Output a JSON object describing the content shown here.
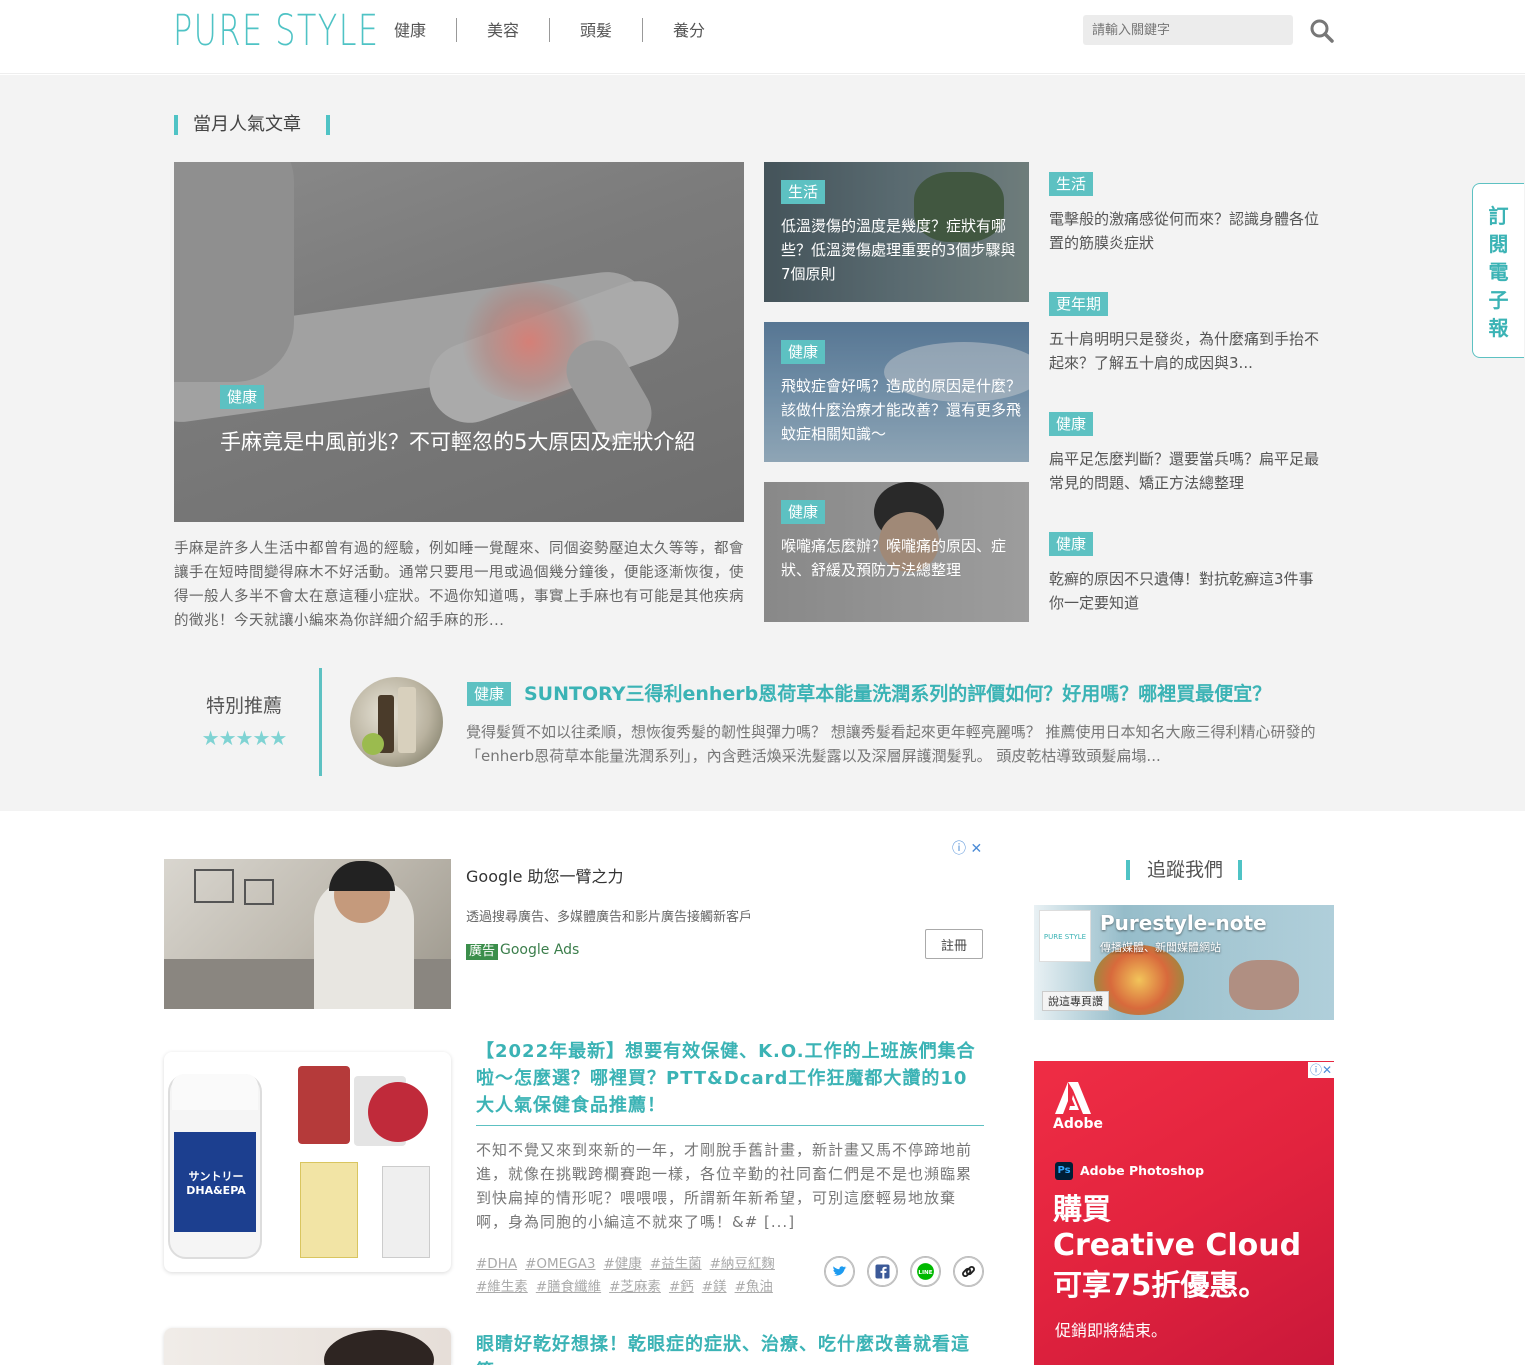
{
  "header": {
    "logo": "PURE STYLE",
    "nav": [
      "健康",
      "美容",
      "頭髮",
      "養分"
    ],
    "search_placeholder": "請輸入關鍵字"
  },
  "featured": {
    "section_title": "當月人氣文章",
    "main": {
      "tag": "健康",
      "title": "手麻竟是中風前兆？不可輕忽的5大原因及症狀介紹",
      "excerpt": "手麻是許多人生活中都曾有過的經驗，例如睡一覺醒來、同個姿勢壓迫太久等等，都會讓手在短時間變得麻木不好活動。通常只要甩一甩或過個幾分鐘後，便能逐漸恢復，使得一般人多半不會太在意這種小症狀。不過你知道嗎，事實上手麻也有可能是其他疾病的徵兆！今天就讓小編來為你詳細介紹手麻的形..."
    },
    "middle": [
      {
        "tag": "生活",
        "title": "低溫燙傷的溫度是幾度？症狀有哪些？低溫燙傷處理重要的3個步驟與7個原則"
      },
      {
        "tag": "健康",
        "title": "飛蚊症會好嗎？造成的原因是什麼？該做什麼治療才能改善？還有更多飛蚊症相關知識～"
      },
      {
        "tag": "健康",
        "title": "喉嚨痛怎麼辦？喉嚨痛的原因、症狀、舒緩及預防方法總整理"
      }
    ],
    "side": [
      {
        "tag": "生活",
        "title": "電擊般的激痛感從何而來？認識身體各位置的筋膜炎症狀"
      },
      {
        "tag": "更年期",
        "title": "五十肩明明只是發炎，為什麼痛到手抬不起來？了解五十肩的成因與3..."
      },
      {
        "tag": "健康",
        "title": "扁平足怎麼判斷？還要當兵嗎？扁平足最常見的問題、矯正方法總整理"
      },
      {
        "tag": "健康",
        "title": "乾癬的原因不只遺傳！對抗乾癬這3件事你一定要知道"
      }
    ]
  },
  "subscribe": {
    "label": [
      "訂",
      "閱",
      "電",
      "子",
      "報"
    ]
  },
  "special": {
    "label": "特別推薦",
    "stars": "★★★★★",
    "tag": "健康",
    "title": "SUNTORY三得利enherb恩荷草本能量洗潤系列的評價如何？好用嗎？哪裡買最便宜？",
    "text": "覺得髮質不如以往柔順，想恢復秀髮的韌性與彈力嗎？ 想讓秀髮看起來更年輕亮麗嗎？ 推薦使用日本知名大廠三得利精心研發的「enherb恩荷草本能量洗潤系列」，內含甦活煥采洗髮露以及深層屏護潤髮乳。 頭皮乾枯導致頭髮扁塌..."
  },
  "ad_google": {
    "title": "Google 助您一臂之力",
    "desc": "透過搜尋廣告、多媒體廣告和影片廣告接觸新客戶",
    "badge": "廣告",
    "brand": "Google Ads",
    "button": "註冊"
  },
  "articles": [
    {
      "title": "【2022年最新】想要有效保健、K.O.工作的上班族們集合啦～怎麼選？哪裡買？PTT&Dcard工作狂魔都大讚的10大人氣保健食品推薦！",
      "text": "不知不覺又來到來新的一年，才剛脫手舊計畫，新計畫又馬不停蹄地前進，就像在挑戰跨欄賽跑一樣，各位辛勤的社同畜仁們是不是也瀕臨累到快扁掉的情形呢？喂喂喂，所謂新年新希望，可別這麼輕易地放棄啊，身為同胞的小編這不就來了嗎！&# [...]",
      "tags_row1": [
        "#DHA",
        "#OMEGA3",
        "#健康",
        "#益生菌",
        "#納豆紅麴"
      ],
      "tags_row2": [
        "#維生素",
        "#膳食纖維",
        "#芝麻素",
        "#鈣",
        "#鎂",
        "#魚油"
      ],
      "product_label": "サントリー DHA&EPA"
    },
    {
      "title": "眼睛好乾好想揉！乾眼症的症狀、治療、吃什麼改善就看這篇"
    }
  ],
  "follow": {
    "title": "追蹤我們",
    "fb_name": "Purestyle-note",
    "fb_sub": "傳播媒體、新聞媒體網站",
    "fb_like": "說這專頁讚"
  },
  "ad_adobe": {
    "brand": "Adobe",
    "product": "Adobe Photoshop",
    "line1": "購買",
    "line2": "Creative Cloud",
    "line3": "可享75折優惠。",
    "footer": "促銷即將結束。"
  },
  "colors": {
    "accent": "#5dc1c2",
    "accent_text": "#3bb3b5",
    "featured_bg": "#f3f3f3",
    "adobe_red": "#e2233e"
  }
}
